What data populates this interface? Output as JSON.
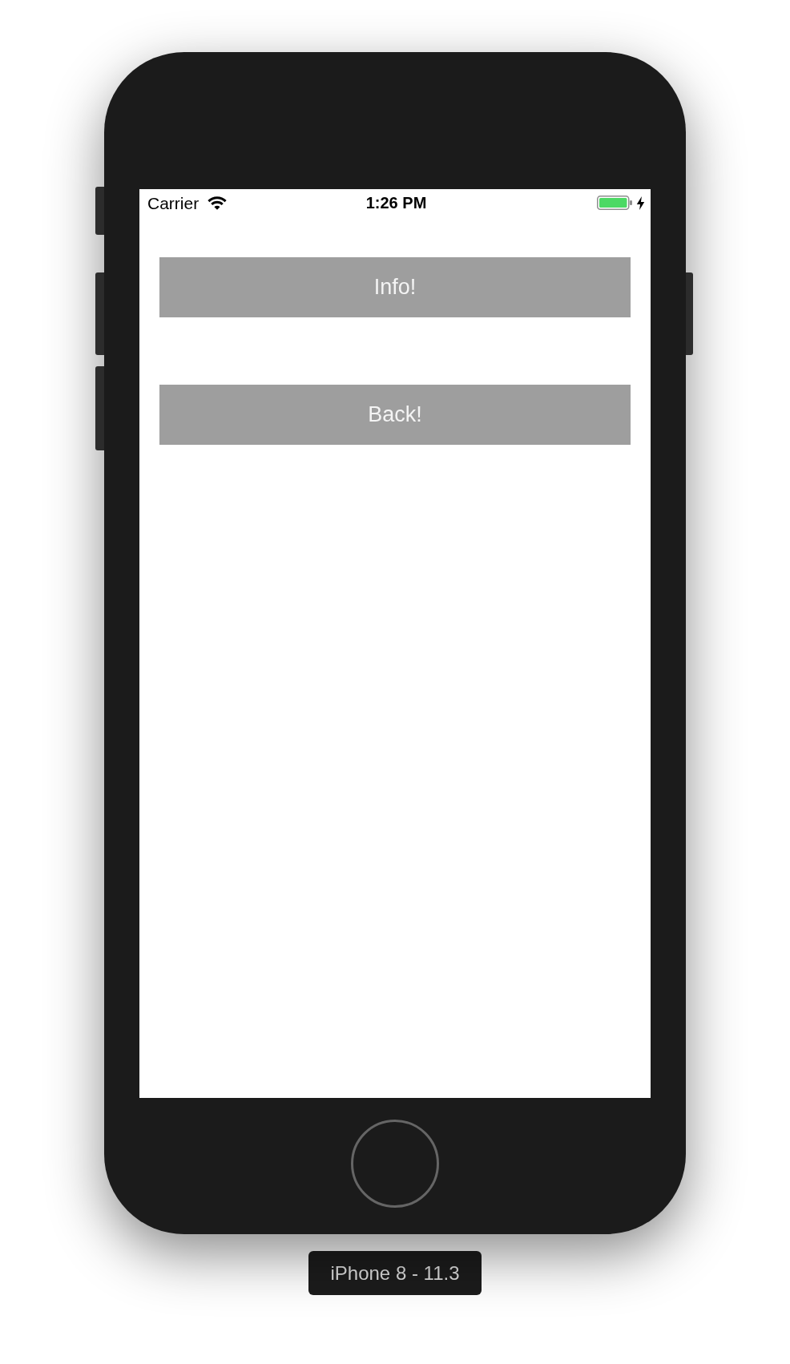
{
  "status_bar": {
    "carrier": "Carrier",
    "time": "1:26 PM",
    "charging": true
  },
  "buttons": [
    {
      "label": "Info!"
    },
    {
      "label": "Back!"
    }
  ],
  "device_label": "iPhone 8 - 11.3"
}
